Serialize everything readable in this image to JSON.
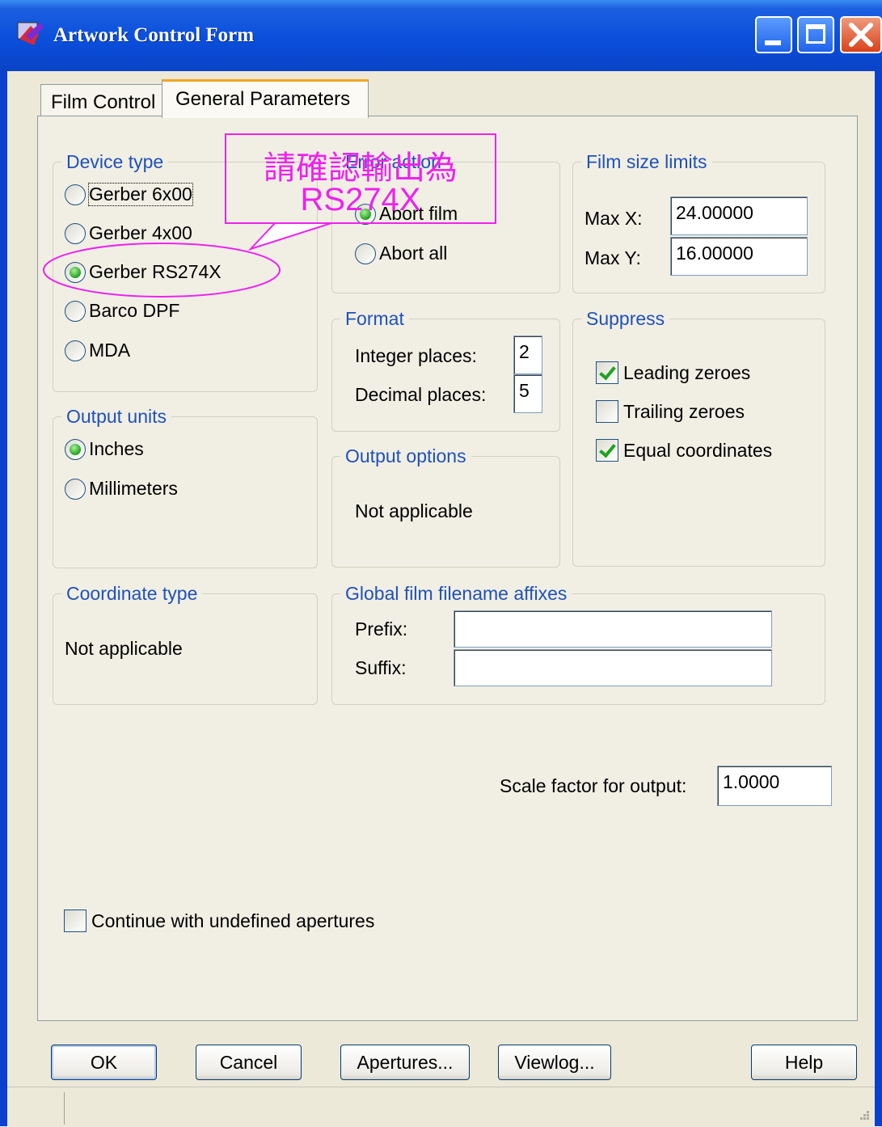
{
  "window": {
    "title": "Artwork Control Form"
  },
  "tabs": [
    {
      "label": "Film Control",
      "active": false
    },
    {
      "label": "General Parameters",
      "active": true
    }
  ],
  "device_type": {
    "title": "Device type",
    "options": [
      "Gerber 6x00",
      "Gerber 4x00",
      "Gerber RS274X",
      "Barco DPF",
      "MDA"
    ],
    "selected": "Gerber RS274X"
  },
  "error_action": {
    "title": "Error action",
    "options": [
      "Abort film",
      "Abort all"
    ],
    "selected": "Abort film"
  },
  "film_size_limits": {
    "title": "Film size limits",
    "max_x_label": "Max X:",
    "max_x_value": "24.00000",
    "max_y_label": "Max Y:",
    "max_y_value": "16.00000"
  },
  "format": {
    "title": "Format",
    "integer_label": "Integer places:",
    "integer_value": "2",
    "decimal_label": "Decimal places:",
    "decimal_value": "5"
  },
  "suppress": {
    "title": "Suppress",
    "items": [
      {
        "label": "Leading zeroes",
        "checked": true
      },
      {
        "label": "Trailing zeroes",
        "checked": false
      },
      {
        "label": "Equal coordinates",
        "checked": true
      }
    ]
  },
  "output_units": {
    "title": "Output units",
    "options": [
      "Inches",
      "Millimeters"
    ],
    "selected": "Inches"
  },
  "output_options": {
    "title": "Output options",
    "text": "Not applicable"
  },
  "coordinate_type": {
    "title": "Coordinate type",
    "text": "Not applicable"
  },
  "filename_affixes": {
    "title": "Global film filename affixes",
    "prefix_label": "Prefix:",
    "prefix_value": "",
    "suffix_label": "Suffix:",
    "suffix_value": ""
  },
  "scale": {
    "label": "Scale factor for output:",
    "value": "1.0000"
  },
  "undefined_apertures": {
    "label": "Continue with undefined apertures",
    "checked": false
  },
  "buttons": {
    "ok": "OK",
    "cancel": "Cancel",
    "apertures": "Apertures...",
    "viewlog": "Viewlog...",
    "help": "Help"
  },
  "annotation": {
    "line1": "請確認輸出為",
    "line2": "RS274X",
    "color": "#ee22ee"
  }
}
